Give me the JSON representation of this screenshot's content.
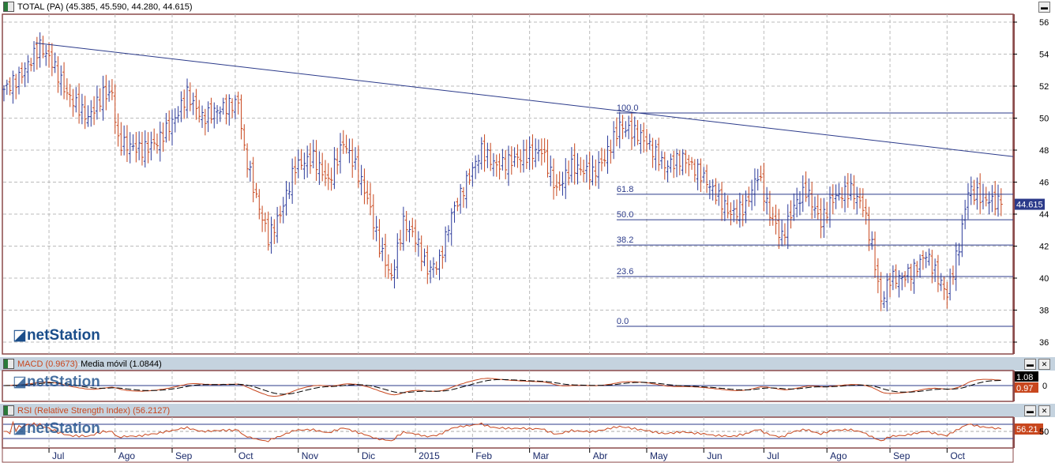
{
  "main": {
    "title": "TOTAL (PA) (45.385, 45.590, 44.280, 44.615)",
    "last_price": "44.615",
    "logo": "netStation"
  },
  "macd": {
    "title": "MACD (0.9673)",
    "sep": " - ",
    "signal_title": "Media móvil (1.0844)",
    "val1": "1.08",
    "val2": "0.97",
    "zero_label": "0"
  },
  "rsi": {
    "title": "RSI (Relative Strength Index) (56.2127)",
    "val": "56.21",
    "mid_label": "50"
  },
  "colors": {
    "up": "#2b3a9a",
    "down": "#c8471e",
    "frame": "#8b4a4a",
    "level": "#2b3a8a"
  },
  "chart_data": {
    "type": "ohlc",
    "x_range": [
      0,
      336
    ],
    "ylim": [
      35.5,
      56.5
    ],
    "y_ticks": [
      36,
      38,
      40,
      42,
      44,
      46,
      48,
      50,
      52,
      54,
      56
    ],
    "months": [
      {
        "d": 15,
        "l": "Jul"
      },
      {
        "d": 37,
        "l": "Ago"
      },
      {
        "d": 56,
        "l": "Sep"
      },
      {
        "d": 77,
        "l": "Oct"
      },
      {
        "d": 98,
        "l": "Nov"
      },
      {
        "d": 118,
        "l": "Dic"
      },
      {
        "d": 137,
        "l": "2015"
      },
      {
        "d": 156,
        "l": "Feb"
      },
      {
        "d": 175,
        "l": "Mar"
      },
      {
        "d": 195,
        "l": "Abr"
      },
      {
        "d": 214,
        "l": "May"
      },
      {
        "d": 233,
        "l": "Jun"
      },
      {
        "d": 253,
        "l": "Jul"
      },
      {
        "d": 274,
        "l": "Ago"
      },
      {
        "d": 295,
        "l": "Sep"
      },
      {
        "d": 314,
        "l": "Oct"
      }
    ],
    "close_keypoints": [
      [
        0,
        51.8
      ],
      [
        5,
        52.5
      ],
      [
        12,
        54.5
      ],
      [
        16,
        53.5
      ],
      [
        21,
        51.5
      ],
      [
        28,
        50
      ],
      [
        33,
        51.5
      ],
      [
        36,
        51.5
      ],
      [
        38,
        48.5
      ],
      [
        46,
        48
      ],
      [
        51,
        48.5
      ],
      [
        57,
        50
      ],
      [
        61,
        51.5
      ],
      [
        66,
        50
      ],
      [
        71,
        50.5
      ],
      [
        78,
        51
      ],
      [
        80,
        48
      ],
      [
        84,
        45
      ],
      [
        88,
        42.5
      ],
      [
        92,
        44
      ],
      [
        97,
        47
      ],
      [
        103,
        47.5
      ],
      [
        108,
        46
      ],
      [
        113,
        48.5
      ],
      [
        117,
        47
      ],
      [
        121,
        45
      ],
      [
        125,
        42
      ],
      [
        129,
        40
      ],
      [
        133,
        43.5
      ],
      [
        137,
        42.5
      ],
      [
        141,
        40.5
      ],
      [
        145,
        41
      ],
      [
        149,
        44
      ],
      [
        154,
        46
      ],
      [
        159,
        48
      ],
      [
        164,
        47
      ],
      [
        171,
        47.5
      ],
      [
        179,
        48
      ],
      [
        184,
        45.5
      ],
      [
        189,
        47
      ],
      [
        196,
        46.5
      ],
      [
        200,
        47.5
      ],
      [
        205,
        49.5
      ],
      [
        211,
        49
      ],
      [
        214,
        48.5
      ],
      [
        220,
        47
      ],
      [
        226,
        47.5
      ],
      [
        232,
        46.5
      ],
      [
        238,
        45
      ],
      [
        242,
        44
      ],
      [
        247,
        44.5
      ],
      [
        251,
        46.5
      ],
      [
        255,
        44
      ],
      [
        259,
        42.5
      ],
      [
        263,
        44.5
      ],
      [
        267,
        45.5
      ],
      [
        272,
        43.5
      ],
      [
        276,
        45
      ],
      [
        282,
        45.5
      ],
      [
        286,
        44.5
      ],
      [
        289,
        42
      ],
      [
        292,
        38.5
      ],
      [
        295,
        40
      ],
      [
        299,
        40
      ],
      [
        303,
        40.5
      ],
      [
        307,
        41.5
      ],
      [
        311,
        40
      ],
      [
        314,
        39
      ],
      [
        318,
        42
      ],
      [
        321,
        45.5
      ],
      [
        326,
        45
      ],
      [
        332,
        44.615
      ]
    ],
    "trendline": [
      [
        10.5,
        54.7
      ],
      [
        336,
        47.6
      ]
    ],
    "fibonacci": {
      "start_day": 204,
      "levels": [
        {
          "label": "100.0",
          "price": 50.32
        },
        {
          "label": "61.8",
          "price": 45.24
        },
        {
          "label": "50.0",
          "price": 43.65
        },
        {
          "label": "38.2",
          "price": 42.07
        },
        {
          "label": "23.6",
          "price": 40.1
        },
        {
          "label": "0.0",
          "price": 36.99
        }
      ]
    }
  }
}
